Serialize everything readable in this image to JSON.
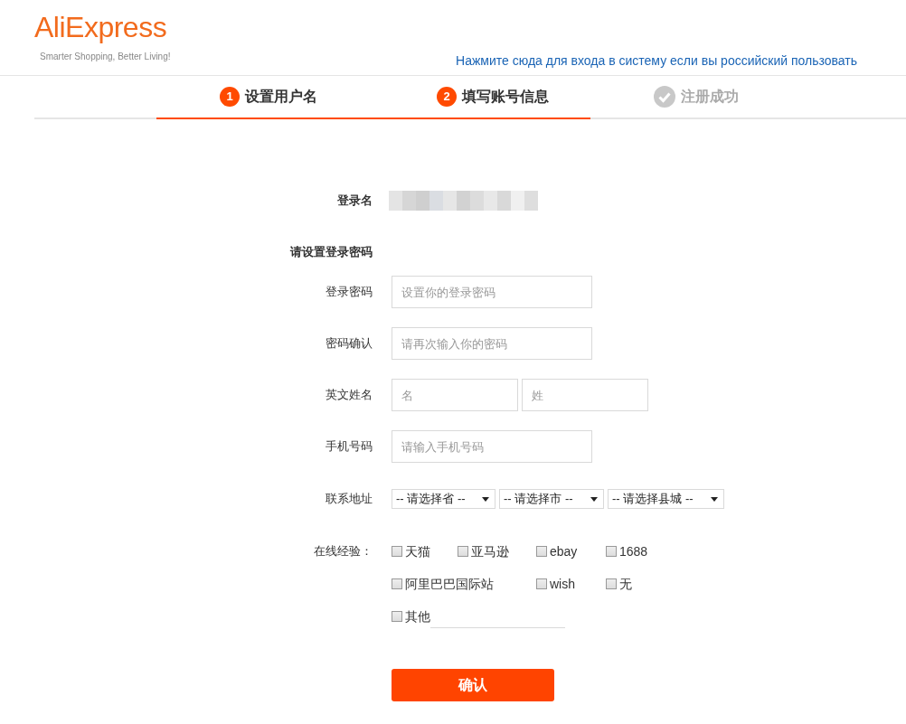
{
  "header": {
    "logo": "AliExpress",
    "tagline": "Smarter Shopping, Better Living!",
    "russian_link": "Нажмите сюда для входа в систему если вы российский пользовать"
  },
  "steps": [
    {
      "kind": "number",
      "marker": "1",
      "label": "设置用户名",
      "reached": true
    },
    {
      "kind": "number",
      "marker": "2",
      "label": "填写账号信息",
      "reached": true
    },
    {
      "kind": "check",
      "label": "注册成功",
      "reached": false
    }
  ],
  "login_name": {
    "label": "登录名"
  },
  "section_title": "请设置登录密码",
  "fields": [
    {
      "label": "登录密码",
      "inputs": [
        {
          "placeholder": "设置你的登录密码"
        }
      ]
    },
    {
      "label": "密码确认",
      "inputs": [
        {
          "placeholder": "请再次输入你的密码"
        }
      ]
    },
    {
      "label": "英文姓名",
      "inputs": [
        {
          "placeholder": "名"
        },
        {
          "placeholder": "姓"
        }
      ]
    },
    {
      "label": "手机号码",
      "inputs": [
        {
          "placeholder": "请输入手机号码"
        }
      ]
    }
  ],
  "address": {
    "label": "联系地址",
    "selects": [
      "-- 请选择省 --",
      "-- 请选择市 --",
      "-- 请选择县城 --"
    ]
  },
  "experience": {
    "label": "在线经验：",
    "options": [
      {
        "label": "天猫",
        "checked": false
      },
      {
        "label": "亚马逊",
        "checked": false
      },
      {
        "label": "ebay",
        "checked": false
      },
      {
        "label": "1688",
        "checked": false
      },
      {
        "label": "阿里巴巴国际站",
        "checked": false
      },
      {
        "label": "wish",
        "checked": false
      },
      {
        "label": "无",
        "checked": false
      },
      {
        "label": "其他",
        "checked": false,
        "kind": "other"
      }
    ]
  },
  "submit": "确认"
}
